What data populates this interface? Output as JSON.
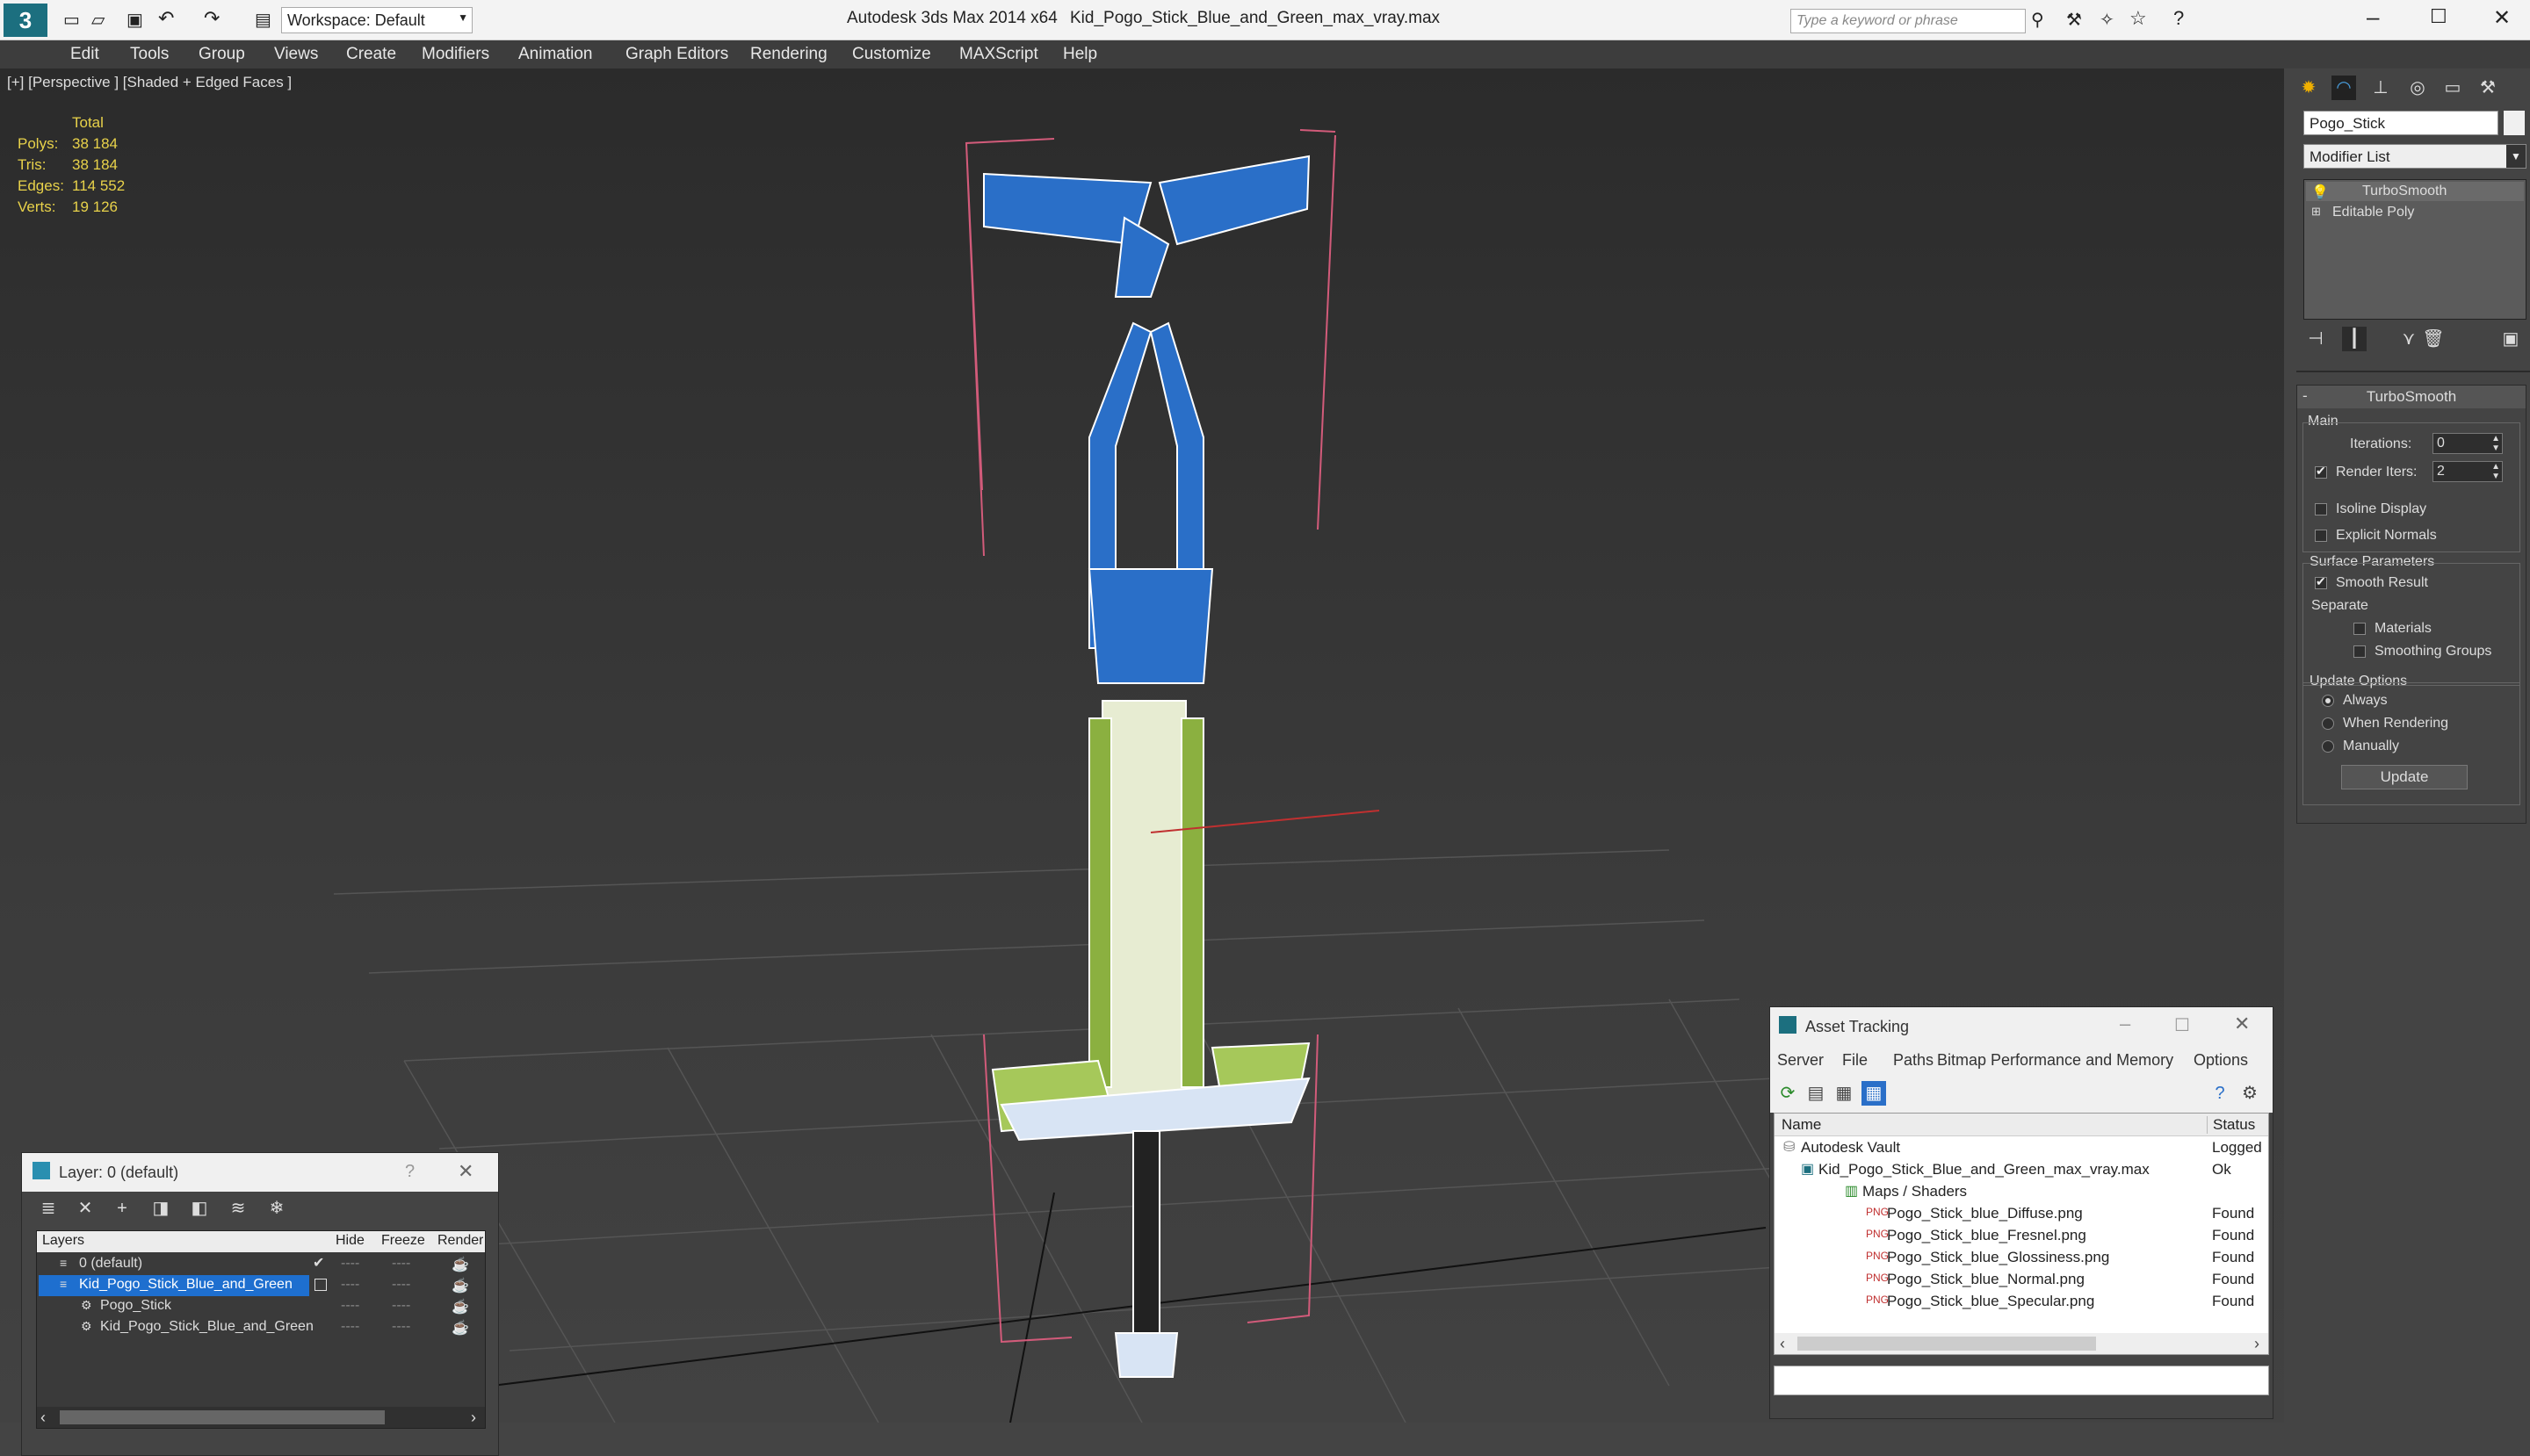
{
  "title": {
    "app": "Autodesk 3ds Max 2014 x64",
    "file": "Kid_Pogo_Stick_Blue_and_Green_max_vray.max",
    "workspace": "Workspace: Default",
    "search_placeholder": "Type a keyword or phrase"
  },
  "menu": [
    "Edit",
    "Tools",
    "Group",
    "Views",
    "Create",
    "Modifiers",
    "Animation",
    "Graph Editors",
    "Rendering",
    "Customize",
    "MAXScript",
    "Help"
  ],
  "viewport": {
    "label": "[+] [Perspective ] [Shaded + Edged Faces ]",
    "stats": {
      "header": "Total",
      "rows": [
        {
          "label": "Polys:",
          "value": "38 184"
        },
        {
          "label": "Tris:",
          "value": "38 184"
        },
        {
          "label": "Edges:",
          "value": "114 552"
        },
        {
          "label": "Verts:",
          "value": "19 126"
        }
      ]
    }
  },
  "command_panel": {
    "object_name": "Pogo_Stick",
    "modifier_list": "Modifier List",
    "stack": [
      "TurboSmooth",
      "Editable Poly"
    ],
    "rollout": "TurboSmooth",
    "main": "Main",
    "iterations_label": "Iterations:",
    "iterations_value": "0",
    "render_iters_label": "Render Iters:",
    "render_iters_value": "2",
    "isoline": "Isoline Display",
    "explicit": "Explicit Normals",
    "surface_params": "Surface Parameters",
    "smooth_result": "Smooth Result",
    "separate": "Separate",
    "materials": "Materials",
    "smoothing_groups": "Smoothing Groups",
    "update_options": "Update Options",
    "always": "Always",
    "when_rendering": "When Rendering",
    "manually": "Manually",
    "update_button": "Update"
  },
  "layer_window": {
    "title": "Layer: 0 (default)",
    "help": "?",
    "columns": [
      "Layers",
      "Hide",
      "Freeze",
      "Render"
    ],
    "rows": [
      {
        "name": "0 (default)",
        "indent": 1
      },
      {
        "name": "Kid_Pogo_Stick_Blue_and_Green",
        "indent": 1,
        "selected": true
      },
      {
        "name": "Pogo_Stick",
        "indent": 2
      },
      {
        "name": "Kid_Pogo_Stick_Blue_and_Green",
        "indent": 2
      }
    ]
  },
  "asset_window": {
    "title": "Asset Tracking",
    "menu": [
      "Server",
      "File",
      "Paths",
      "Bitmap Performance and Memory",
      "Options"
    ],
    "columns": [
      "Name",
      "Status"
    ],
    "rows": [
      {
        "name": "Autodesk Vault",
        "status": "Logged",
        "indent": 0
      },
      {
        "name": "Kid_Pogo_Stick_Blue_and_Green_max_vray.max",
        "status": "Ok",
        "indent": 1
      },
      {
        "name": "Maps / Shaders",
        "status": "",
        "indent": 2
      },
      {
        "name": "Pogo_Stick_blue_Diffuse.png",
        "status": "Found",
        "indent": 3
      },
      {
        "name": "Pogo_Stick_blue_Fresnel.png",
        "status": "Found",
        "indent": 3
      },
      {
        "name": "Pogo_Stick_blue_Glossiness.png",
        "status": "Found",
        "indent": 3
      },
      {
        "name": "Pogo_Stick_blue_Normal.png",
        "status": "Found",
        "indent": 3
      },
      {
        "name": "Pogo_Stick_blue_Specular.png",
        "status": "Found",
        "indent": 3
      }
    ]
  }
}
